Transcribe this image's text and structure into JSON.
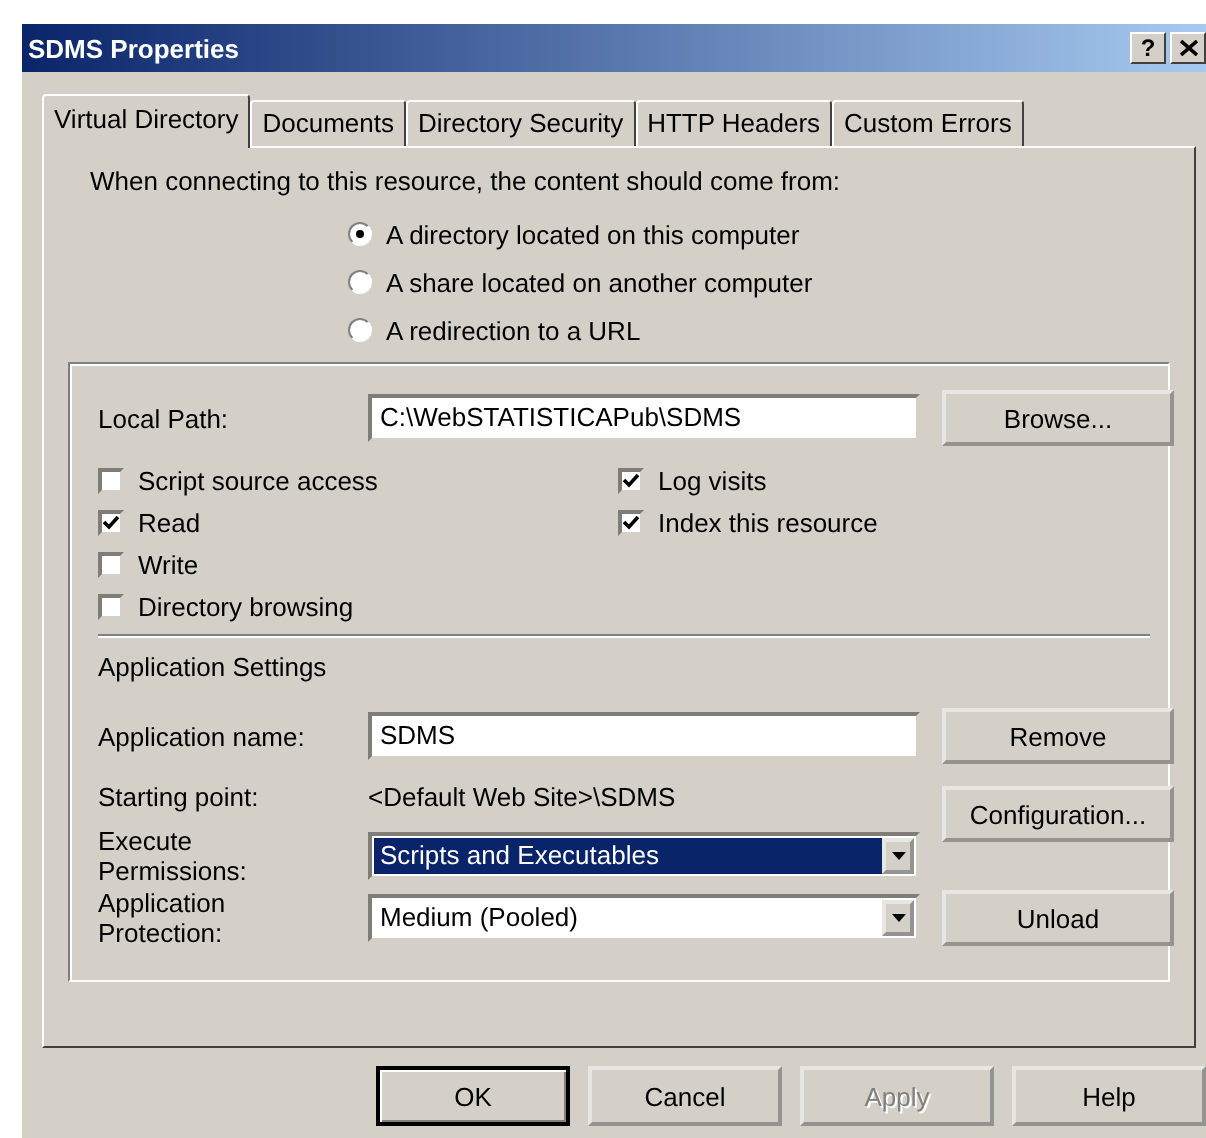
{
  "window": {
    "title": "SDMS Properties",
    "help_button": "?"
  },
  "tabs": [
    {
      "label": "Virtual Directory",
      "selected": true
    },
    {
      "label": "Documents",
      "selected": false
    },
    {
      "label": "Directory Security",
      "selected": false
    },
    {
      "label": "HTTP Headers",
      "selected": false
    },
    {
      "label": "Custom Errors",
      "selected": false
    }
  ],
  "source": {
    "prompt": "When connecting to this resource, the content should come from:",
    "options": [
      {
        "label": "A directory located on this computer",
        "selected": true
      },
      {
        "label": "A share located on another computer",
        "selected": false
      },
      {
        "label": "A redirection to a URL",
        "selected": false
      }
    ]
  },
  "local_path": {
    "label": "Local Path:",
    "value": "C:\\WebSTATISTICAPub\\SDMS",
    "button": "Browse..."
  },
  "checkboxes_left": [
    {
      "label": "Script source access",
      "checked": false
    },
    {
      "label": "Read",
      "checked": true
    },
    {
      "label": "Write",
      "checked": false
    },
    {
      "label": "Directory browsing",
      "checked": false
    }
  ],
  "checkboxes_right": [
    {
      "label": "Log visits",
      "checked": true
    },
    {
      "label": "Index this resource",
      "checked": true
    }
  ],
  "application_settings": {
    "heading": "Application Settings",
    "name": {
      "label": "Application name:",
      "value": "SDMS",
      "button": "Remove"
    },
    "starting_point": {
      "label": "Starting point:",
      "value": "<Default Web Site>\\SDMS"
    },
    "configuration_button": "Configuration...",
    "execute_permissions": {
      "label": "Execute Permissions:",
      "value": "Scripts and Executables",
      "focused": true
    },
    "application_protection": {
      "label": "Application Protection:",
      "value": "Medium (Pooled)",
      "focused": false
    },
    "unload_button": "Unload"
  },
  "buttons": [
    {
      "label": "OK",
      "default": true,
      "disabled": false
    },
    {
      "label": "Cancel",
      "default": false,
      "disabled": false
    },
    {
      "label": "Apply",
      "default": false,
      "disabled": true
    },
    {
      "label": "Help",
      "default": false,
      "disabled": false
    }
  ]
}
